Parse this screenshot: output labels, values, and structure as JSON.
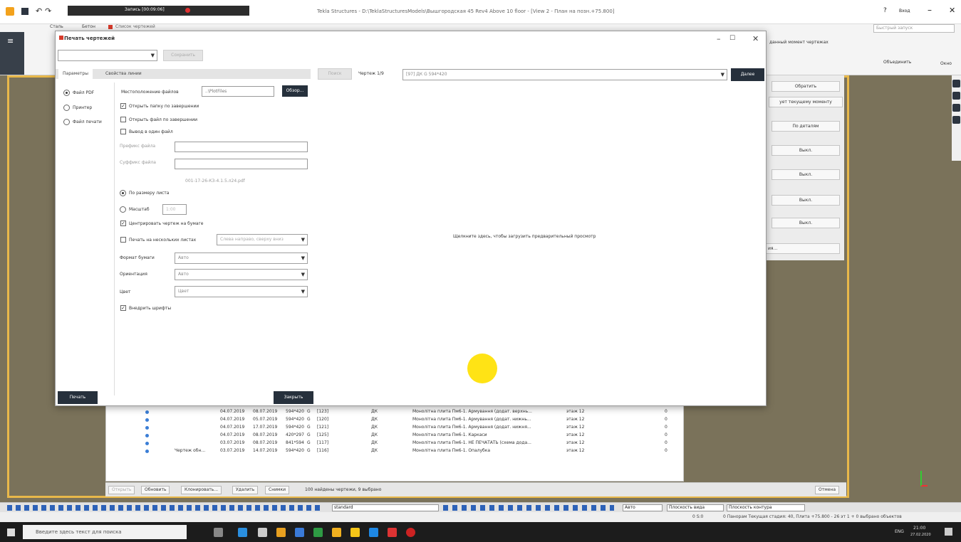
{
  "window": {
    "title": "Tekla Structures - D:\\TeklaStructuresModels\\Вышгородская 45 Rev4 Above 10 floor - [View 2 - План на позн.+75.800]",
    "recording_label": "Запись [00:09:06]",
    "help": "?",
    "login": "Вход",
    "search_placeholder": "Быстрый запуск"
  },
  "ribbon": {
    "tabs": [
      "Сталь",
      "Бетон"
    ],
    "drawing_list_tab": "Список чертежей",
    "right_hint": "данный момент чертежах",
    "right_label": "Объединить",
    "right_label2": "Окно"
  },
  "right_panel": {
    "buttons": [
      "Обратить",
      "ует текущему моменту",
      "По деталям",
      "Выкл.",
      "Выкл.",
      "Выкл.",
      "Выкл.",
      "ия..."
    ]
  },
  "dialog": {
    "title": "Печать чертежей",
    "save_button": "Сохранить",
    "tabs": {
      "params": "Параметры",
      "line_props": "Свойства линии"
    },
    "apply_button": "Поиск",
    "drawing_counter": "Чертеж 1/9",
    "drawing_select": "[97] ДК G 594*420",
    "next_button": "Далее",
    "output": {
      "pdf": "Файл PDF",
      "printer": "Принтер",
      "print_file": "Файл печати"
    },
    "location_label": "Местоположение файлов",
    "location_value": "..\\PlotFiles",
    "browse_button": "Обзор...",
    "open_folder": "Открыть папку по завершении",
    "open_file": "Открыть файл по завершении",
    "single_file": "Вывод в один файл",
    "prefix_label": "Префикс файла",
    "suffix_label": "Суффикс файла",
    "filename_preview": "001-17-26-КЗ-4.1.5.л24.pdf",
    "fit_to_sheet": "По размеру листа",
    "scale_label": "Масштаб",
    "scale_value": "1:00",
    "center_drawing": "Центрировать чертеж на бумаге",
    "multi_sheet": "Печать на нескольких листах",
    "multi_sheet_order": "Слева направо, сверху вниз",
    "paper_label": "Формат бумаги",
    "paper_value": "Авто",
    "orientation_label": "Ориентация",
    "orientation_value": "Авто",
    "color_label": "Цвет",
    "color_value": "Цвет",
    "embed_fonts": "Внедрить шрифты",
    "preview_hint": "Щелкните здесь, чтобы загрузить предварительный просмотр",
    "print_button": "Печать",
    "close_button": "Закрыть"
  },
  "list": {
    "rows": [
      [
        "",
        "04.07.2019",
        "08.07.2019",
        "594*420",
        "G",
        "[123]",
        "ДК",
        "Монолітна плита Пм6-1. Армування (додат. верхнь...",
        "этаж 12",
        "0"
      ],
      [
        "",
        "04.07.2019",
        "05.07.2019",
        "594*420",
        "G",
        "[120]",
        "ДК",
        "Монолітна плита Пм6-1. Армування (додат. нижнь...",
        "этаж 12",
        "0"
      ],
      [
        "",
        "04.07.2019",
        "17.07.2019",
        "594*420",
        "G",
        "[121]",
        "ДК",
        "Монолітна плита Пм6-1. Армування (додат. нижня...",
        "этаж 12",
        "0"
      ],
      [
        "",
        "04.07.2019",
        "08.07.2019",
        "420*297",
        "G",
        "[125]",
        "ДК",
        "Монолітна плита Пм6-1. Каркаси",
        "этаж 12",
        "0"
      ],
      [
        "",
        "03.07.2019",
        "08.07.2019",
        "841*594",
        "G",
        "[117]",
        "ДК",
        "Монолітна плита Пм6-1. НЕ ПЕЧАТАТЬ (схема дода...",
        "этаж 12",
        "0"
      ],
      [
        "Чертеж обн...",
        "03.07.2019",
        "14.07.2019",
        "594*420",
        "G",
        "[116]",
        "ДК",
        "Монолітна плита Пм6-1. Опалубка",
        "этаж 12",
        "0"
      ]
    ]
  },
  "list_toolbar": {
    "open": "Открыть",
    "refresh": "Обновить",
    "clone": "Клонировать...",
    "delete": "Удалить",
    "snapshots": "Снимки",
    "found": "100 найдены чертежи, 9 выбрано",
    "cancel": "Отмена"
  },
  "toolstrip": {
    "standard": "standard",
    "auto": "Авто",
    "view_plane": "Плоскость вида",
    "work_plane": "Плоскость контура"
  },
  "status": {
    "left": "0  S:0",
    "text": "0   Панорам Текущая стадия: 40, Плита +75.800 - 26 эт 1 + 0 выбрано объектов"
  },
  "taskbar": {
    "search": "Введите здесь текст для поиска",
    "lang": "ENG",
    "time": "21:00",
    "date": "27.02.2020"
  }
}
